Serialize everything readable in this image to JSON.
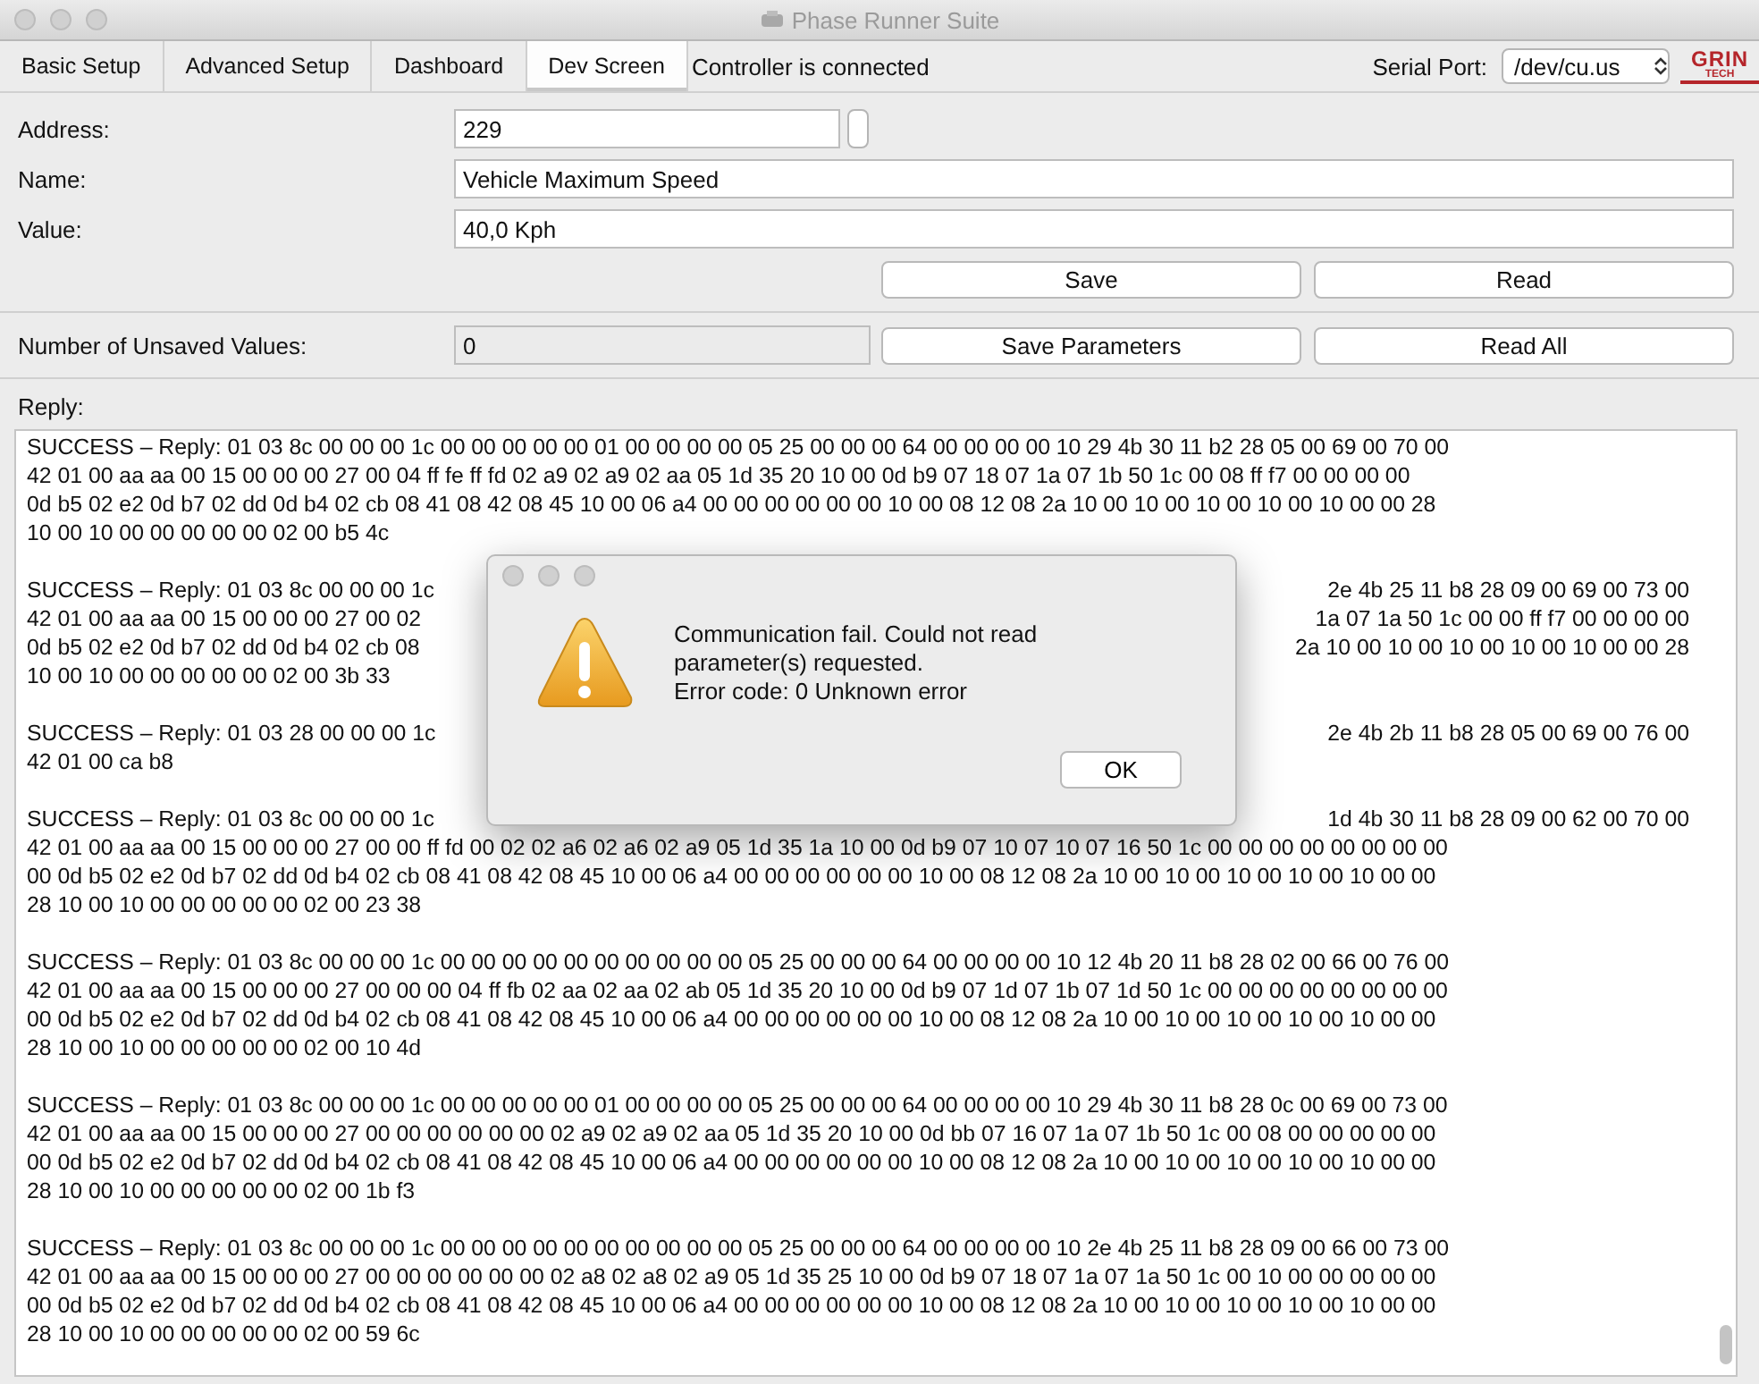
{
  "window": {
    "title": "Phase Runner Suite"
  },
  "tabs": [
    {
      "label": "Basic Setup",
      "selected": false
    },
    {
      "label": "Advanced Setup",
      "selected": false
    },
    {
      "label": "Dashboard",
      "selected": false
    },
    {
      "label": "Dev Screen",
      "selected": true
    }
  ],
  "status": "Controller is connected",
  "serial_port": {
    "label": "Serial Port:",
    "value": "/dev/cu.us"
  },
  "logo": {
    "top": "GRIN",
    "bottom": "TECH"
  },
  "fields": [
    {
      "label": "Address:",
      "value": "229"
    },
    {
      "label": "Name:",
      "value": "Vehicle Maximum Speed"
    },
    {
      "label": "Value:",
      "value": "40,0 Kph"
    }
  ],
  "buttons": [
    "Save",
    "Read"
  ],
  "unsaved": {
    "label": "Number of Unsaved Values:",
    "value": "0",
    "buttons": [
      "Save Parameters",
      "Read All"
    ]
  },
  "reply": {
    "label": "Reply:",
    "entries": [
      {
        "lines": [
          {
            "kind": "full",
            "text": "SUCCESS – Reply: 01 03 8c 00 00 00 1c 00 00 00 00 00 01 00 00 00 00 05 25 00 00 00 64 00 00 00 00 10 29 4b 30 11 b2 28 05 00 69 00 70 00"
          },
          {
            "kind": "full",
            "text": "42 01 00 aa aa 00 15 00 00 00 27 00 04 ff fe ff fd 02 a9 02 a9 02 aa 05 1d 35 20 10 00 0d b9 07 18 07 1a 07 1b 50 1c 00 08 ff f7 00 00 00 00"
          },
          {
            "kind": "full",
            "text": "0d b5 02 e2 0d b7 02 dd 0d b4 02 cb 08 41 08 42 08 45 10 00 06 a4 00 00 00 00 00 00 10 00 08 12 08 2a 10 00 10 00 10 00 10 00 10 00 00 28"
          },
          {
            "kind": "full",
            "text": "10 00 10 00 00 00 00 00 02 00 b5 4c"
          }
        ]
      },
      {
        "lines": [
          {
            "kind": "cut",
            "left": "SUCCESS – Reply: 01 03 8c 00 00 00 1c",
            "right": "2e 4b 25 11 b8 28 09 00 69 00 73 00"
          },
          {
            "kind": "cut",
            "left": "42 01 00 aa aa 00 15 00 00 00 27 00 02",
            "right": "1a 07 1a 50 1c 00 00 ff f7 00 00 00 00"
          },
          {
            "kind": "cut",
            "left": "0d b5 02 e2 0d b7 02 dd 0d b4 02 cb 08",
            "right": "2a 10 00 10 00 10 00 10 00 10 00 00 28"
          },
          {
            "kind": "full",
            "text": "10 00 10 00 00 00 00 00 02 00 3b 33"
          }
        ]
      },
      {
        "lines": [
          {
            "kind": "cut",
            "left": "SUCCESS – Reply: 01 03 28 00 00 00 1c",
            "right": "2e 4b 2b 11 b8 28 05 00 69 00 76 00"
          },
          {
            "kind": "full",
            "text": "42 01 00 ca b8"
          }
        ]
      },
      {
        "lines": [
          {
            "kind": "cut",
            "left": "SUCCESS – Reply: 01 03 8c 00 00 00 1c",
            "right": "1d 4b 30 11 b8 28 09 00 62 00 70 00"
          },
          {
            "kind": "full",
            "text": "42 01 00 aa aa 00 15 00 00 00 27 00 00 ff fd 00 02 02 a6 02 a6 02 a9 05 1d 35 1a 10 00 0d b9 07 10 07 10 07 16 50 1c 00 00 00 00 00 00 00 00"
          },
          {
            "kind": "full",
            "text": "00 0d b5 02 e2 0d b7 02 dd 0d b4 02 cb 08 41 08 42 08 45 10 00 06 a4 00 00 00 00 00 00 10 00 08 12 08 2a 10 00 10 00 10 00 10 00 10 00 00"
          },
          {
            "kind": "full",
            "text": "28 10 00 10 00 00 00 00 00 02 00 23 38"
          }
        ]
      },
      {
        "lines": [
          {
            "kind": "full",
            "text": "SUCCESS – Reply: 01 03 8c 00 00 00 1c 00 00 00 00 00 00 00 00 00 00 05 25 00 00 00 64 00 00 00 00 10 12 4b 20 11 b8 28 02 00 66 00 76 00"
          },
          {
            "kind": "full",
            "text": "42 01 00 aa aa 00 15 00 00 00 27 00 00 00 04 ff fb 02 aa 02 aa 02 ab 05 1d 35 20 10 00 0d b9 07 1d 07 1b 07 1d 50 1c 00 00 00 00 00 00 00 00"
          },
          {
            "kind": "full",
            "text": "00 0d b5 02 e2 0d b7 02 dd 0d b4 02 cb 08 41 08 42 08 45 10 00 06 a4 00 00 00 00 00 00 10 00 08 12 08 2a 10 00 10 00 10 00 10 00 10 00 00"
          },
          {
            "kind": "full",
            "text": "28 10 00 10 00 00 00 00 00 02 00 10 4d"
          }
        ]
      },
      {
        "lines": [
          {
            "kind": "full",
            "text": "SUCCESS – Reply: 01 03 8c 00 00 00 1c 00 00 00 00 00 01 00 00 00 00 05 25 00 00 00 64 00 00 00 00 10 29 4b 30 11 b8 28 0c 00 69 00 73 00"
          },
          {
            "kind": "full",
            "text": "42 01 00 aa aa 00 15 00 00 00 27 00 00 00 00 00 00 02 a9 02 a9 02 aa 05 1d 35 20 10 00 0d bb 07 16 07 1a 07 1b 50 1c 00 08 00 00 00 00 00"
          },
          {
            "kind": "full",
            "text": "00 0d b5 02 e2 0d b7 02 dd 0d b4 02 cb 08 41 08 42 08 45 10 00 06 a4 00 00 00 00 00 00 10 00 08 12 08 2a 10 00 10 00 10 00 10 00 10 00 00"
          },
          {
            "kind": "full",
            "text": "28 10 00 10 00 00 00 00 00 02 00 1b f3"
          }
        ]
      },
      {
        "lines": [
          {
            "kind": "full",
            "text": "SUCCESS – Reply: 01 03 8c 00 00 00 1c 00 00 00 00 00 00 00 00 00 00 05 25 00 00 00 64 00 00 00 00 10 2e 4b 25 11 b8 28 09 00 66 00 73 00"
          },
          {
            "kind": "full",
            "text": "42 01 00 aa aa 00 15 00 00 00 27 00 00 00 00 00 00 02 a8 02 a8 02 a9 05 1d 35 25 10 00 0d b9 07 18 07 1a 07 1a 50 1c 00 10 00 00 00 00 00"
          },
          {
            "kind": "full",
            "text": "00 0d b5 02 e2 0d b7 02 dd 0d b4 02 cb 08 41 08 42 08 45 10 00 06 a4 00 00 00 00 00 00 10 00 08 12 08 2a 10 00 10 00 10 00 10 00 10 00 00"
          },
          {
            "kind": "full",
            "text": "28 10 00 10 00 00 00 00 00 02 00 59 6c"
          }
        ]
      }
    ]
  },
  "dialog": {
    "message": "Communication fail. Could not read parameter(s) requested.",
    "error": "Error code: 0 Unknown error",
    "button": "OK"
  }
}
